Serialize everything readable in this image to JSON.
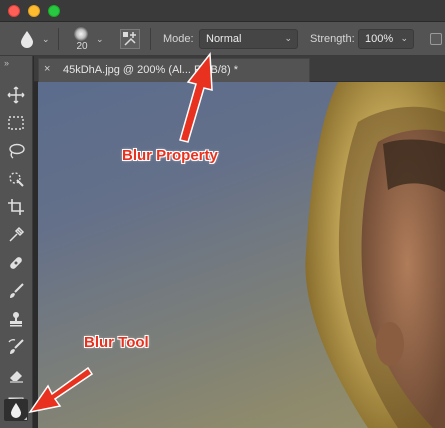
{
  "window": {
    "controls": [
      "close",
      "minimize",
      "zoom"
    ]
  },
  "options_bar": {
    "tool_icon": "blur-tool-icon",
    "brush_size": "20",
    "mode_label": "Mode:",
    "mode_value": "Normal",
    "strength_label": "Strength:",
    "strength_value": "100%"
  },
  "toolbar": {
    "grip": "››",
    "tools": [
      {
        "icon": "move-icon"
      },
      {
        "icon": "marquee-icon"
      },
      {
        "icon": "lasso-icon"
      },
      {
        "icon": "quick-selection-icon"
      },
      {
        "icon": "crop-icon"
      },
      {
        "icon": "eyedropper-icon"
      },
      {
        "icon": "healing-brush-icon"
      },
      {
        "icon": "brush-icon"
      },
      {
        "icon": "clone-stamp-icon"
      },
      {
        "icon": "history-brush-icon"
      },
      {
        "icon": "eraser-icon"
      },
      {
        "icon": "gradient-icon"
      },
      {
        "icon": "blur-tool-icon",
        "active": true
      }
    ]
  },
  "document_tab": {
    "close": "×",
    "title": "45kDhA.jpg @ 200% (Al... RGB/8) *"
  },
  "annotations": {
    "blur_property": "Blur Property",
    "blur_tool": "Blur Tool",
    "color": "#e8321f"
  }
}
